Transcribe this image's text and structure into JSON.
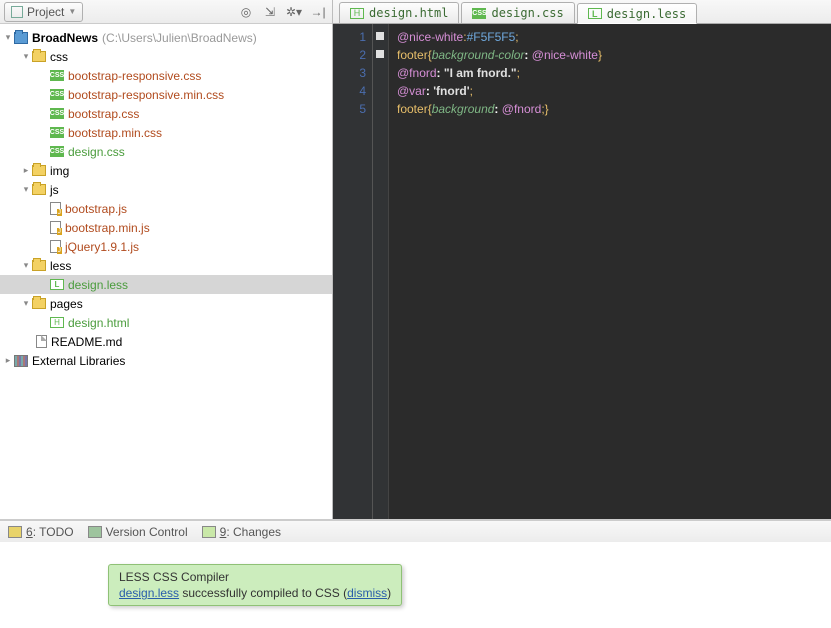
{
  "projectPanel": {
    "title": "Project",
    "root": {
      "name": "BroadNews",
      "path": "(C:\\Users\\Julien\\BroadNews)"
    },
    "folders": {
      "css": "css",
      "img": "img",
      "js": "js",
      "less": "less",
      "pages": "pages"
    },
    "files": {
      "css": [
        "bootstrap-responsive.css",
        "bootstrap-responsive.min.css",
        "bootstrap.css",
        "bootstrap.min.css",
        "design.css"
      ],
      "js": [
        "bootstrap.js",
        "bootstrap.min.js",
        "jQuery1.9.1.js"
      ],
      "less": [
        "design.less"
      ],
      "pages": [
        "design.html"
      ],
      "readme": "README.md"
    },
    "extLib": "External Libraries"
  },
  "tabs": [
    {
      "label": "design.html",
      "kind": "html"
    },
    {
      "label": "design.css",
      "kind": "css"
    },
    {
      "label": "design.less",
      "kind": "less",
      "active": true
    }
  ],
  "code": {
    "lines": [
      {
        "n": 1,
        "tokens": [
          [
            "tk-var",
            "@nice-white"
          ],
          [
            "tk-punc",
            ":"
          ],
          [
            "tk-val",
            "#F5F5F5"
          ],
          [
            "tk-punc",
            ";"
          ]
        ]
      },
      {
        "n": 2,
        "tokens": [
          [
            "tk-sel",
            "footer"
          ],
          [
            "tk-punc",
            "{"
          ],
          [
            "tk-prop",
            "background-color"
          ],
          [
            "tk-white",
            ": "
          ],
          [
            "tk-ref",
            "@nice-white"
          ],
          [
            "tk-punc",
            "}"
          ]
        ]
      },
      {
        "n": 3,
        "tokens": [
          [
            "tk-var",
            "@fnord"
          ],
          [
            "tk-white",
            ": "
          ],
          [
            "tk-str",
            "\"I am fnord.\""
          ],
          [
            "tk-punc",
            ";"
          ]
        ]
      },
      {
        "n": 4,
        "tokens": [
          [
            "tk-var",
            "@var"
          ],
          [
            "tk-white",
            ": "
          ],
          [
            "tk-str",
            "'fnord'"
          ],
          [
            "tk-punc",
            ";"
          ]
        ]
      },
      {
        "n": 5,
        "tokens": [
          [
            "tk-sel",
            "footer"
          ],
          [
            "tk-punc",
            "{"
          ],
          [
            "tk-prop",
            "background"
          ],
          [
            "tk-white",
            ": "
          ],
          [
            "tk-ref",
            "@fnord"
          ],
          [
            "tk-punc",
            ";}"
          ]
        ]
      }
    ]
  },
  "notification": {
    "title": "LESS CSS Compiler",
    "link1": "design.less",
    "mid": " successfully compiled to CSS (",
    "link2": "dismiss",
    "end": ")"
  },
  "status": {
    "todo": "6: TODO",
    "vcs": "Version Control",
    "changes": "9: Changes"
  }
}
